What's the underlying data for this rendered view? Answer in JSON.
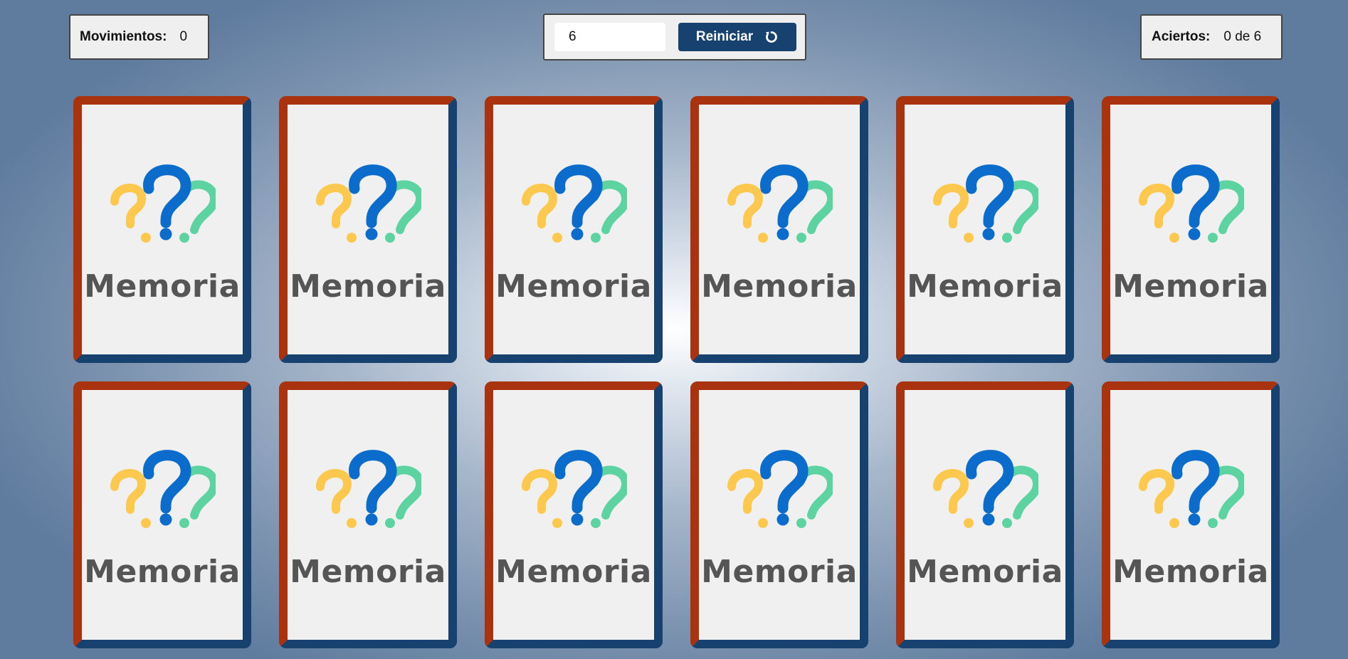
{
  "stats": {
    "moves_label": "Movimientos:",
    "moves_value": "0",
    "hits_label": "Aciertos:",
    "hits_value": "0 de 6"
  },
  "controls": {
    "pairs_value": "6",
    "restart_label": "Reiniciar",
    "restart_icon": "refresh-icon"
  },
  "card_back": {
    "title": "Memoria",
    "icon": "question-marks-icon",
    "colors": {
      "border_top_left": "#a9330f",
      "border_bottom_right": "#17416f",
      "face": "#f0f0f0",
      "qmark_yellow": "#fdc84e",
      "qmark_blue": "#0b6ccc",
      "qmark_green": "#5dd3a1"
    }
  },
  "board": {
    "columns": 6,
    "rows": 2,
    "cards": [
      {
        "state": "face-down"
      },
      {
        "state": "face-down"
      },
      {
        "state": "face-down"
      },
      {
        "state": "face-down"
      },
      {
        "state": "face-down"
      },
      {
        "state": "face-down"
      },
      {
        "state": "face-down"
      },
      {
        "state": "face-down"
      },
      {
        "state": "face-down"
      },
      {
        "state": "face-down"
      },
      {
        "state": "face-down"
      },
      {
        "state": "face-down"
      }
    ]
  }
}
